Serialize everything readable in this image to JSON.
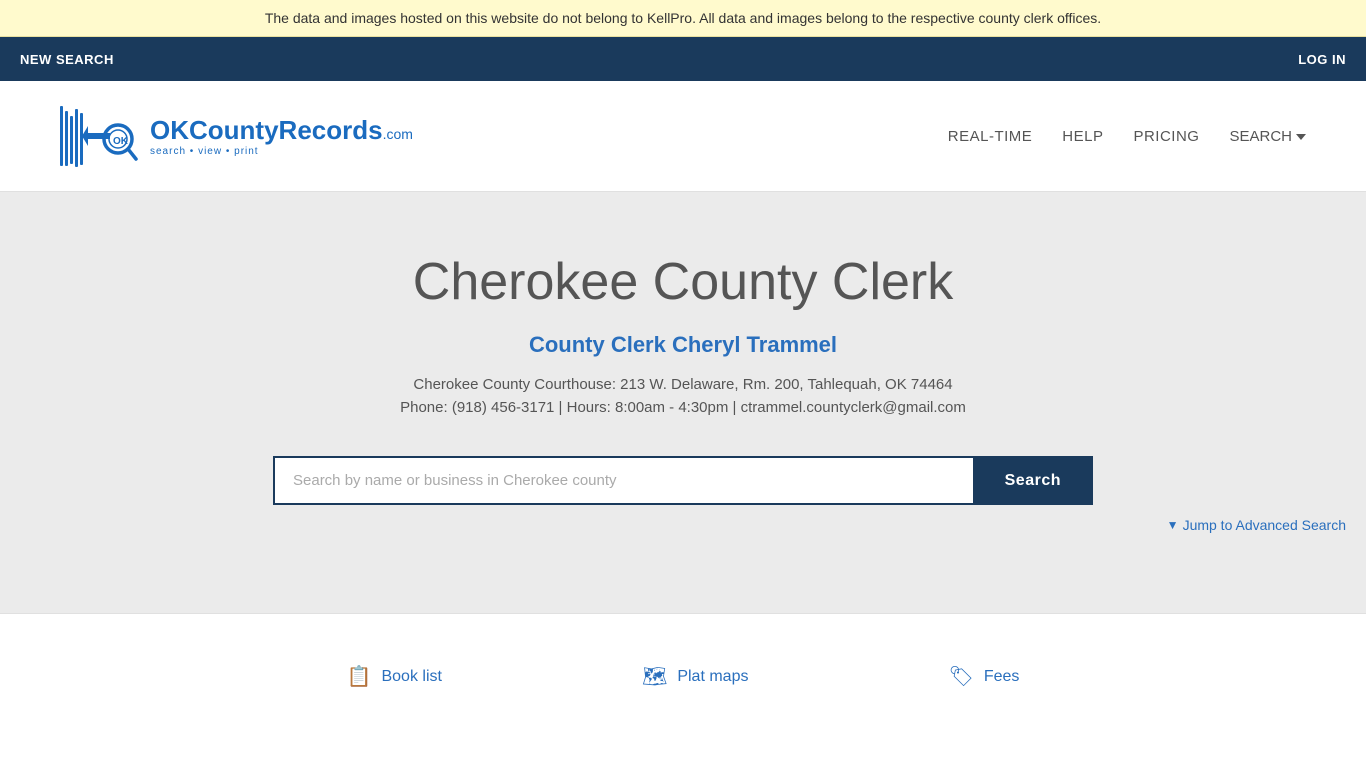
{
  "banner": {
    "text": "The data and images hosted on this website do not belong to KellPro. All data and images belong to the respective county clerk offices."
  },
  "topnav": {
    "new_search": "NEW SEARCH",
    "login": "LOG IN"
  },
  "header": {
    "logo_brand": "OKCountyRecords",
    "logo_com": ".com",
    "logo_tagline": "search • view • print",
    "nav": {
      "realtime": "REAL-TIME",
      "help": "HELP",
      "pricing": "PRICING",
      "search": "SEARCH"
    }
  },
  "hero": {
    "title": "Cherokee County Clerk",
    "subtitle": "County Clerk Cheryl Trammel",
    "address": "Cherokee County Courthouse: 213 W. Delaware, Rm. 200, Tahlequah, OK 74464",
    "phone": "Phone: (918) 456-3171 | Hours: 8:00am - 4:30pm | ctrammel.countyclerk@gmail.com",
    "search_placeholder": "Search by name or business in Cherokee county",
    "search_button": "Search",
    "advanced_search": "Jump to Advanced Search"
  },
  "footer_links": [
    {
      "id": "book-list",
      "label": "Book list",
      "icon": "📋"
    },
    {
      "id": "plat-maps",
      "label": "Plat maps",
      "icon": "🗺"
    },
    {
      "id": "fees",
      "label": "Fees",
      "icon": "🏷"
    }
  ]
}
